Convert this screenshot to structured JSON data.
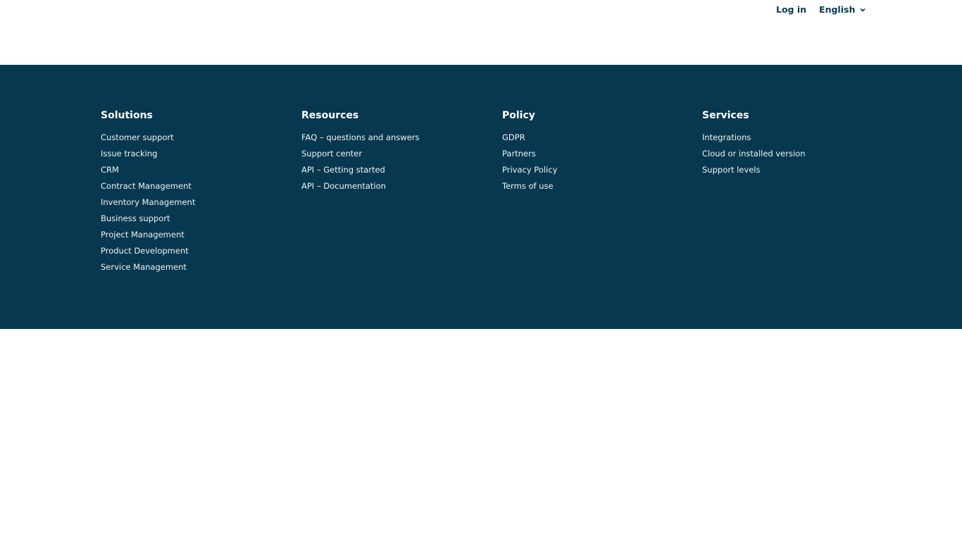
{
  "header": {
    "login_label": "Log in",
    "language": {
      "selected": "English",
      "icon": "chevron-down-icon"
    }
  },
  "footer": {
    "columns": [
      {
        "title": "Solutions",
        "links": [
          "Customer support",
          "Issue tracking",
          "CRM",
          "Contract Management",
          "Inventory Management",
          "Business support",
          "Project Management",
          "Product Development",
          "Service Management"
        ]
      },
      {
        "title": "Resources",
        "links": [
          "FAQ – questions and answers",
          "Support center",
          "API – Getting started",
          "API – Documentation"
        ]
      },
      {
        "title": "Policy",
        "links": [
          "GDPR",
          "Partners",
          "Privacy Policy",
          "Terms of use"
        ]
      },
      {
        "title": "Services",
        "links": [
          "Integrations",
          "Cloud or installed version",
          "Support levels"
        ]
      }
    ]
  },
  "colors": {
    "footer_background": "#07384f",
    "header_text": "#093b52"
  }
}
